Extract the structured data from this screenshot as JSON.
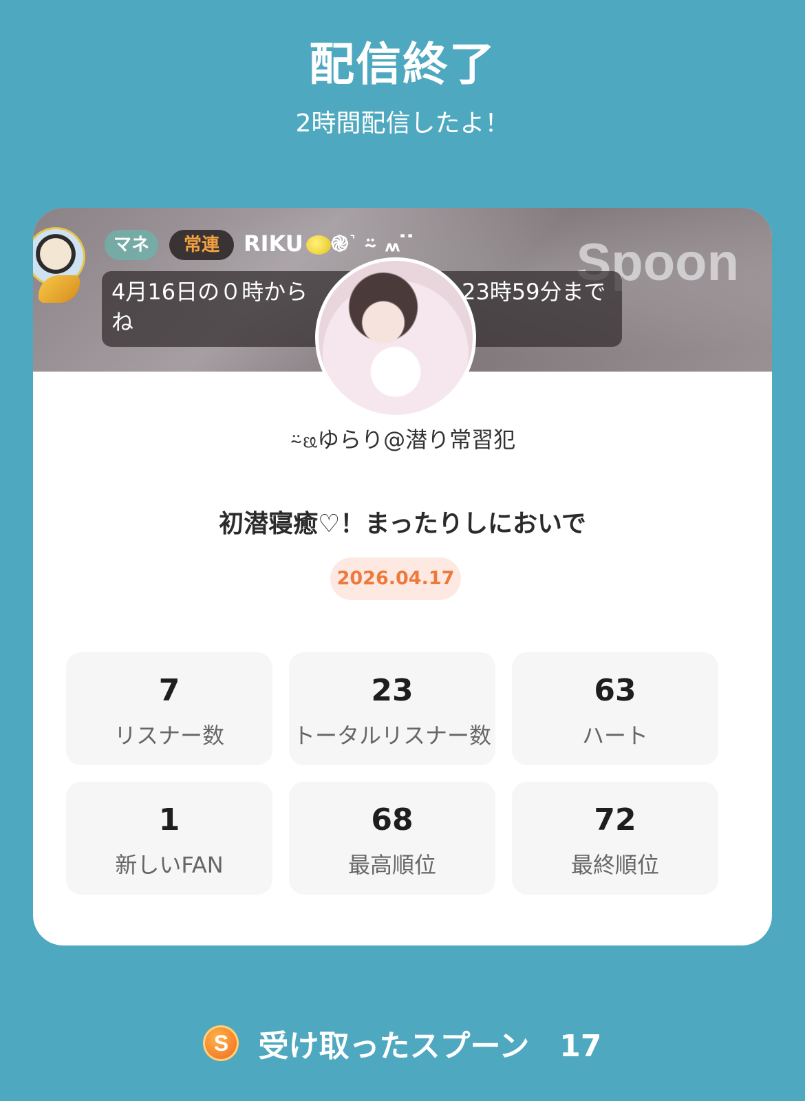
{
  "header": {
    "title": "配信終了",
    "subtitle": "2時間配信したよ！"
  },
  "banner": {
    "logo_text": "Spoon",
    "chat": {
      "tag_1": "マネ",
      "tag_2": "常連",
      "name": "RIKU",
      "name_suffix": "֎˺ ⍨ ៳ ̇ ̇",
      "message": "4月16日の０時から　　　　　　　23時59分までね"
    }
  },
  "profile": {
    "username": "⍨ᦕゆらり@潜り常習犯"
  },
  "stream": {
    "title": "初潜寝癒♡！まったりしにおいで",
    "date": "2026.04.17"
  },
  "stats": [
    {
      "value": "7",
      "label": "リスナー数"
    },
    {
      "value": "23",
      "label": "トータルリスナー数"
    },
    {
      "value": "63",
      "label": "ハート"
    },
    {
      "value": "1",
      "label": "新しいFAN"
    },
    {
      "value": "68",
      "label": "最高順位"
    },
    {
      "value": "72",
      "label": "最終順位"
    }
  ],
  "footer": {
    "coin_letter": "S",
    "spoons_label": "受け取ったスプーン　17"
  }
}
